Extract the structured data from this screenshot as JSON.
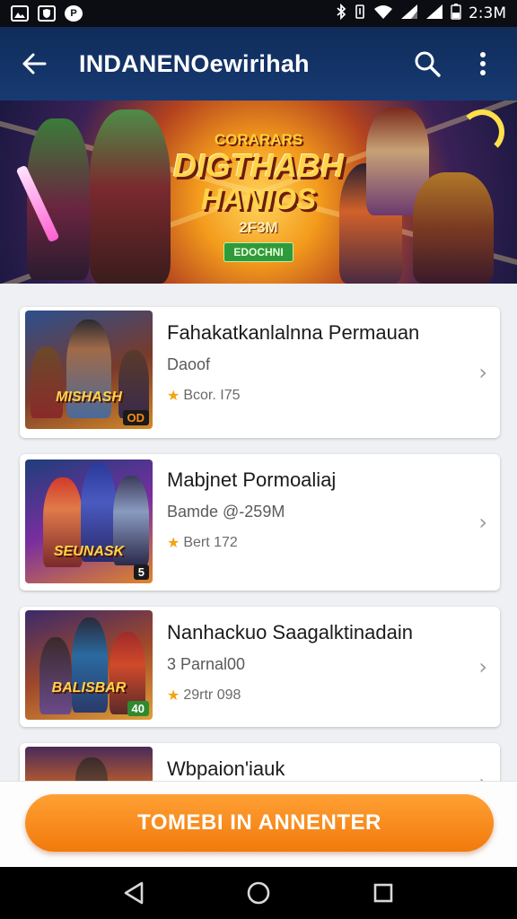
{
  "status_bar": {
    "time": "2:3M",
    "left_icons": [
      "image-icon",
      "shield-app-icon",
      "round-app-icon"
    ],
    "right_icons": [
      "bluetooth-icon",
      "vibrate-icon",
      "wifi-icon",
      "signal-icon",
      "signal-icon",
      "battery-icon"
    ]
  },
  "app_bar": {
    "title": "INDANENOewirihah",
    "icons": [
      "back-arrow-icon",
      "search-icon",
      "more-vert-icon"
    ],
    "background": "#173a72"
  },
  "hero": {
    "line1": "CORARARS",
    "line2": "DIGTHABH",
    "line3": "HANIOS",
    "line4": "2F3M",
    "badge": "EDOCHNI"
  },
  "games": [
    {
      "name": "Fahakatkanlalnna Permauan",
      "subtitle": "Daoof",
      "rating": "Bcor. I75",
      "thumb_title": "MISHASH",
      "corner_label": "OD"
    },
    {
      "name": "Mabjnet Pormoaliaj",
      "subtitle": "Bamde @-259M",
      "rating": "Bert 172",
      "thumb_title": "SEUNASK",
      "corner_label": "5"
    },
    {
      "name": "Nanhackuo Saagalktinadain",
      "subtitle": "3 Parnal00",
      "rating": "29rtr 098",
      "thumb_title": "BALISBAR",
      "corner_label": "40"
    },
    {
      "name": "Wbpaion'iauk",
      "subtitle": "",
      "rating": "",
      "thumb_title": "",
      "corner_label": ""
    }
  ],
  "cta": {
    "label": "TOMEBI IN ANNENTER",
    "color": "#f27a0c"
  },
  "nav_bar": {
    "icons": [
      "back-triangle-icon",
      "home-circle-icon",
      "recents-square-icon"
    ]
  }
}
